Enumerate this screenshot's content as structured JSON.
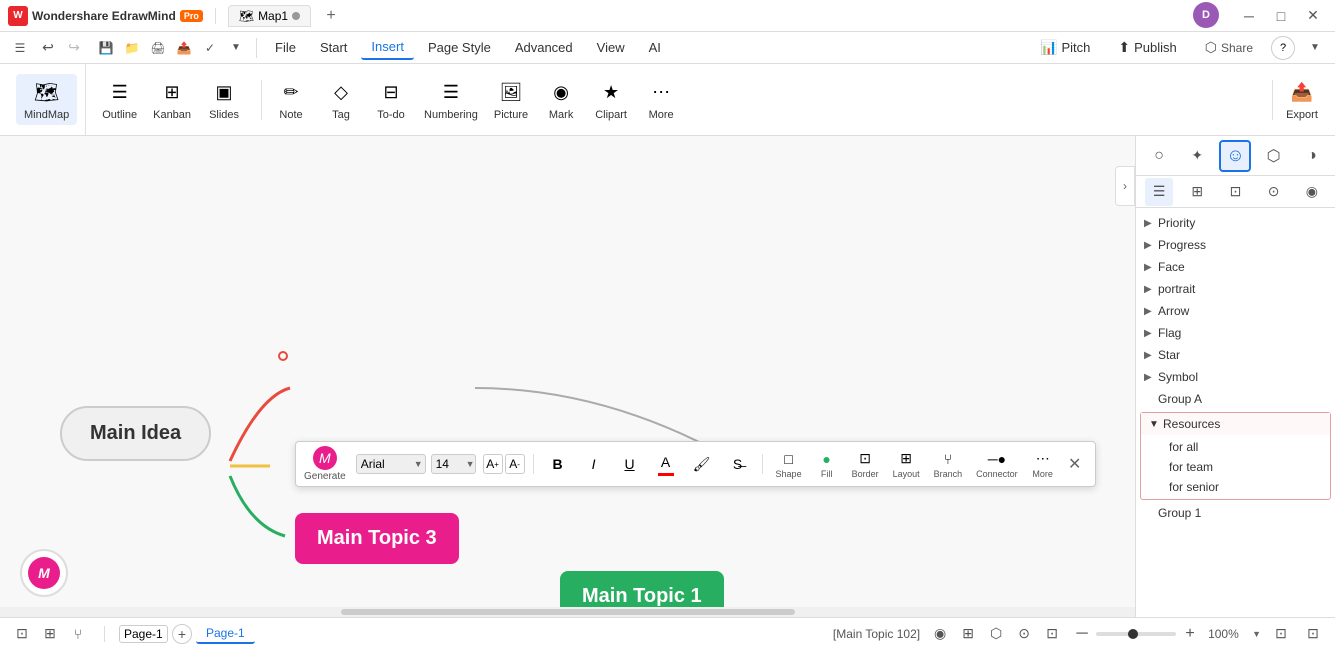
{
  "titlebar": {
    "app_name": "Wondershare EdrawMind",
    "pro_label": "Pro",
    "tab_name": "Map1",
    "tab_dot": "●",
    "new_tab": "+",
    "user_initial": "D",
    "minimize": "─",
    "maximize": "□",
    "close": "✕"
  },
  "menubar": {
    "toggle": "≡",
    "undo": "↩",
    "redo": "↪",
    "items": [
      "File",
      "Start",
      "Insert",
      "Page Style",
      "Advanced",
      "View",
      "AI"
    ],
    "active_item": "Insert",
    "pitch": "Pitch",
    "publish": "Publish",
    "share": "Share",
    "help": "?"
  },
  "toolbar": {
    "tools": [
      {
        "id": "mindmap",
        "label": "MindMap",
        "icon": "🗺"
      },
      {
        "id": "outline",
        "label": "Outline",
        "icon": "☰"
      },
      {
        "id": "kanban",
        "label": "Kanban",
        "icon": "⊞"
      },
      {
        "id": "slides",
        "label": "Slides",
        "icon": "▣"
      }
    ],
    "insert_tools": [
      {
        "id": "note",
        "label": "Note",
        "icon": "✏"
      },
      {
        "id": "tag",
        "label": "Tag",
        "icon": "◇"
      },
      {
        "id": "todo",
        "label": "To-do",
        "icon": "⊟"
      },
      {
        "id": "numbering",
        "label": "Numbering",
        "icon": "☰"
      },
      {
        "id": "picture",
        "label": "Picture",
        "icon": "🖼"
      },
      {
        "id": "mark",
        "label": "Mark",
        "icon": "◉"
      },
      {
        "id": "clipart",
        "label": "Clipart",
        "icon": "★"
      },
      {
        "id": "more",
        "label": "More",
        "icon": "⋯"
      }
    ],
    "export": "Export"
  },
  "text_toolbar": {
    "generate_label": "Generate",
    "font": "Arial",
    "font_size": "14",
    "increase_icon": "A+",
    "decrease_icon": "A-",
    "bold": "B",
    "italic": "I",
    "underline": "U",
    "tools": [
      {
        "id": "shape",
        "icon": "□",
        "label": "Shape"
      },
      {
        "id": "fill",
        "icon": "●",
        "label": "Fill"
      },
      {
        "id": "border",
        "icon": "⊡",
        "label": "Border"
      },
      {
        "id": "layout",
        "icon": "⊞",
        "label": "Layout"
      },
      {
        "id": "branch",
        "icon": "⑂",
        "label": "Branch"
      },
      {
        "id": "connector",
        "icon": "─",
        "label": "Connector"
      },
      {
        "id": "more",
        "icon": "⋯",
        "label": "More"
      }
    ]
  },
  "canvas": {
    "main_idea": "Main Idea",
    "topic1": "Main Topic 1",
    "topic3": "Main Topic 3",
    "connector_label": "Connector"
  },
  "right_panel": {
    "panel_icons": [
      "○",
      "✦",
      "☺",
      "⬡",
      "◑"
    ],
    "sub_icons": [
      "☰",
      "⊞",
      "⊡",
      "⊙",
      "◉"
    ],
    "tree_items": [
      {
        "id": "priority",
        "label": "Priority",
        "has_arrow": true,
        "expanded": false
      },
      {
        "id": "progress",
        "label": "Progress",
        "has_arrow": true,
        "expanded": false
      },
      {
        "id": "face",
        "label": "Face",
        "has_arrow": true,
        "expanded": false
      },
      {
        "id": "portrait",
        "label": "portrait",
        "has_arrow": true,
        "expanded": false
      },
      {
        "id": "arrow",
        "label": "Arrow",
        "has_arrow": true,
        "expanded": false
      },
      {
        "id": "flag",
        "label": "Flag",
        "has_arrow": true,
        "expanded": false
      },
      {
        "id": "star",
        "label": "Star",
        "has_arrow": true,
        "expanded": false
      },
      {
        "id": "symbol",
        "label": "Symbol",
        "has_arrow": true,
        "expanded": false
      },
      {
        "id": "group_a",
        "label": "Group A",
        "has_arrow": false,
        "expanded": false
      }
    ],
    "resources": {
      "label": "Resources",
      "expanded": true,
      "items": [
        "for all",
        "for team",
        "for senior"
      ]
    },
    "group1": "Group 1"
  },
  "statusbar": {
    "icons": [
      "⊡",
      "⊞",
      "⑂"
    ],
    "page_label": "Page-1",
    "page_tab": "Page-1",
    "add_page": "+",
    "status_text": "[Main Topic 102]",
    "fit_icons": [
      "◉",
      "⊞",
      "⬡",
      "⊙",
      "⊡"
    ],
    "zoom_minus": "─",
    "zoom_slider_pos": "50%",
    "zoom_plus": "+",
    "zoom_level": "100%",
    "expand_icon": "⊡",
    "fullscreen_icon": "⊡"
  }
}
